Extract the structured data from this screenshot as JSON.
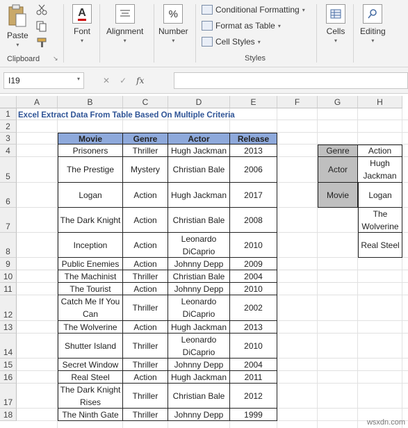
{
  "ribbon": {
    "clipboard": {
      "paste": "Paste",
      "group": "Clipboard"
    },
    "font": {
      "label": "Font"
    },
    "alignment": {
      "label": "Alignment"
    },
    "number": {
      "label": "Number",
      "symbol": "%"
    },
    "styles": {
      "conditional": "Conditional Formatting",
      "format_table": "Format as Table",
      "cell_styles": "Cell Styles",
      "group": "Styles"
    },
    "cells": {
      "label": "Cells"
    },
    "editing": {
      "label": "Editing"
    }
  },
  "formula_bar": {
    "name_box": "I19",
    "fx": "fx",
    "cancel": "✕",
    "enter": "✓",
    "formula": ""
  },
  "columns": [
    "A",
    "B",
    "C",
    "D",
    "E",
    "F",
    "G",
    "H"
  ],
  "rows": [
    "1",
    "2",
    "3",
    "4",
    "5",
    "6",
    "7",
    "8",
    "9",
    "10",
    "11",
    "12",
    "13",
    "14",
    "15",
    "16",
    "17",
    "18"
  ],
  "sheet_title": "Excel Extract Data From Table Based On Multiple Criteria",
  "table": {
    "headers": [
      "Movie",
      "Genre",
      "Actor",
      "Release"
    ],
    "rows": [
      [
        "Prisoners",
        "Thriller",
        "Hugh Jackman",
        "2013"
      ],
      [
        "The Prestige",
        "Mystery",
        "Christian Bale",
        "2006"
      ],
      [
        "Logan",
        "Action",
        "Hugh Jackman",
        "2017"
      ],
      [
        "The Dark Knight",
        "Action",
        "Christian Bale",
        "2008"
      ],
      [
        "Inception",
        "Action",
        "Leonardo DiCaprio",
        "2010"
      ],
      [
        "Public Enemies",
        "Action",
        "Johnny Depp",
        "2009"
      ],
      [
        "The Machinist",
        "Thriller",
        "Christian Bale",
        "2004"
      ],
      [
        "The Tourist",
        "Action",
        "Johnny Depp",
        "2010"
      ],
      [
        "Catch Me If You Can",
        "Thriller",
        "Leonardo DiCaprio",
        "2002"
      ],
      [
        "The Wolverine",
        "Action",
        "Hugh Jackman",
        "2013"
      ],
      [
        "Shutter Island",
        "Thriller",
        "Leonardo DiCaprio",
        "2010"
      ],
      [
        "Secret Window",
        "Thriller",
        "Johnny Depp",
        "2004"
      ],
      [
        "Real Steel",
        "Action",
        "Hugh Jackman",
        "2011"
      ],
      [
        "The Dark Knight Rises",
        "Thriller",
        "Christian Bale",
        "2012"
      ],
      [
        "The Ninth Gate",
        "Thriller",
        "Johnny Depp",
        "1999"
      ]
    ]
  },
  "criteria": {
    "genre_label": "Genre",
    "genre_value": "Action",
    "actor_label": "Actor",
    "actor_value": "Hugh Jackman",
    "movie_label": "Movie",
    "results": [
      "Logan",
      "The Wolverine",
      "Real Steel"
    ]
  },
  "watermark": "wsxdn.com",
  "colors": {
    "header_blue": "#8ea9db",
    "criteria_gray": "#bfbfbf",
    "title_blue": "#2f5496"
  }
}
